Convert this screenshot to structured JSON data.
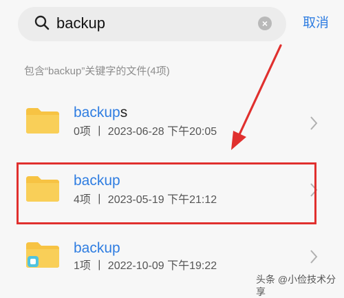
{
  "search": {
    "query": "backup",
    "clear_symbol": "×",
    "cancel_label": "取消"
  },
  "section": {
    "label": "包含“backup”关键字的文件(4项)"
  },
  "results": [
    {
      "name_highlight": "backup",
      "name_rest": "s",
      "meta": "0项 丨 2023-06-28 下午20:05",
      "icon": "folder-icon"
    },
    {
      "name_highlight": "backup",
      "name_rest": "",
      "meta": "4项 丨 2023-05-19 下午21:12",
      "icon": "folder-icon"
    },
    {
      "name_highlight": "backup",
      "name_rest": "",
      "meta": "1项 丨 2022-10-09 下午19:22",
      "icon": "folder-app-icon"
    }
  ],
  "watermark": "头条 @小俭技术分享",
  "colors": {
    "accent": "#2f7de1",
    "folder": "#f7c343",
    "annotation": "#e0302e"
  }
}
